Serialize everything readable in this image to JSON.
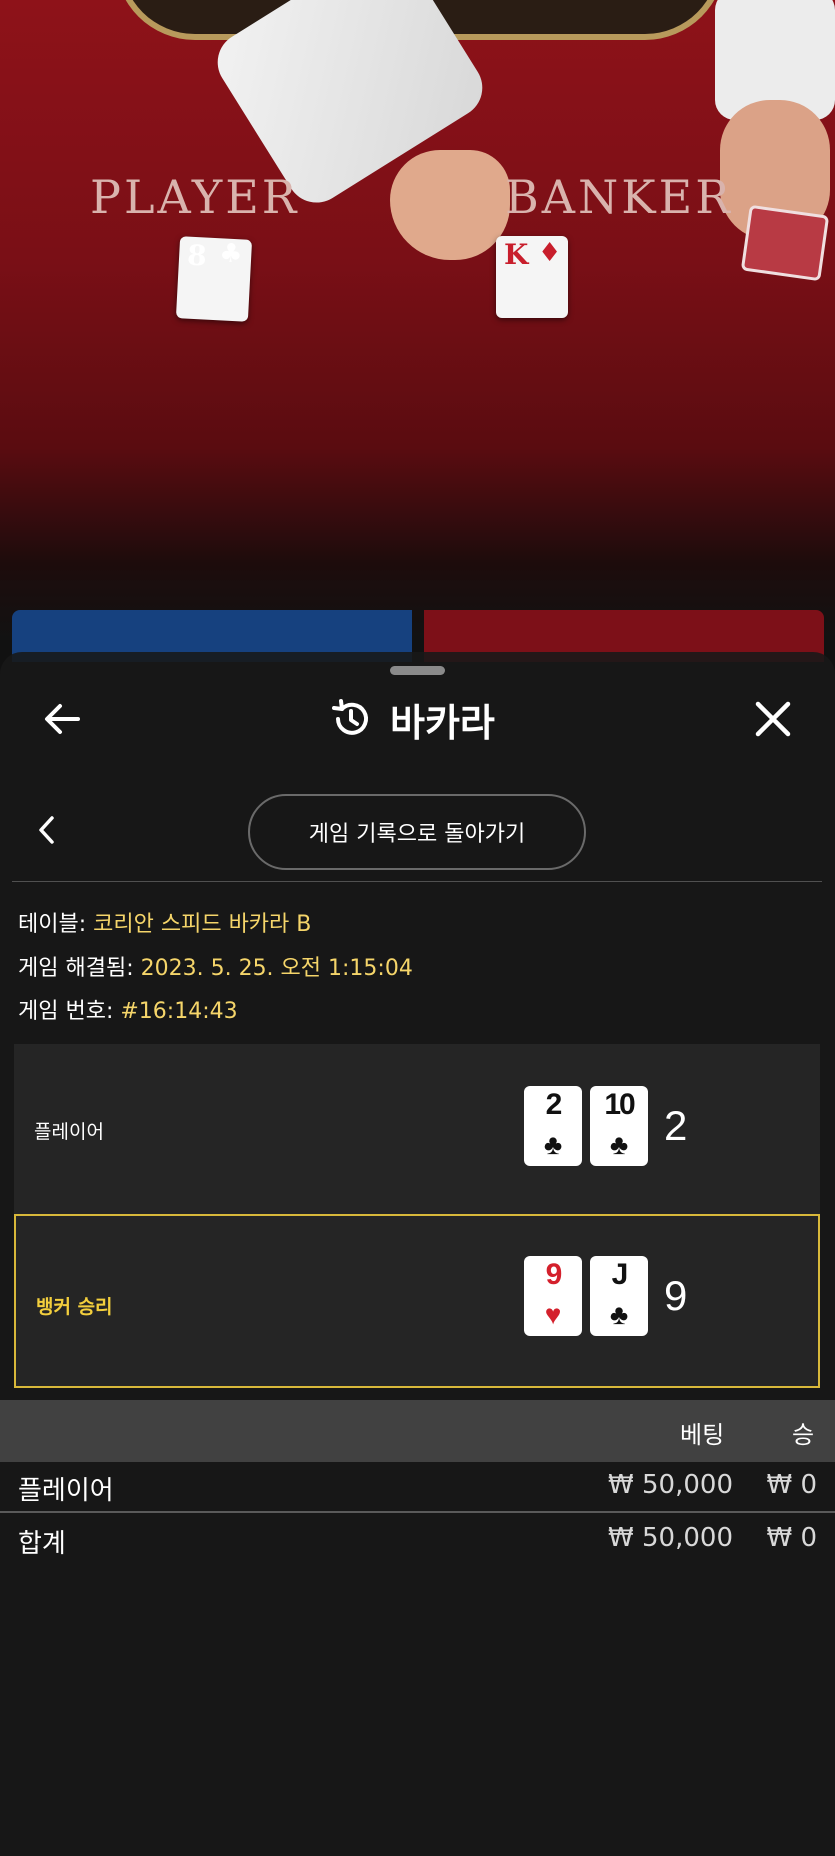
{
  "video": {
    "player_label": "PLAYER",
    "banker_label": "BANKER",
    "player_card": {
      "rank": "8",
      "suit": "♣"
    },
    "banker_card": {
      "rank": "K",
      "suit": "♦"
    }
  },
  "header": {
    "title": "바카라",
    "back_icon": "arrow-left-icon",
    "history_icon": "history-icon",
    "close_icon": "close-icon"
  },
  "nav": {
    "back_to_history_label": "게임 기록으로 돌아가기"
  },
  "info": {
    "table_label": "테이블: ",
    "table_value": "코리안 스피드 바카라 B",
    "resolved_label": "게임 해결됨: ",
    "resolved_value": "2023. 5. 25. 오전 1:15:04",
    "game_no_label": "게임 번호: ",
    "game_no_value": "#16:14:43"
  },
  "results": {
    "player": {
      "label": "플레이어",
      "cards": [
        {
          "rank": "2",
          "suit": "♣",
          "color": "black"
        },
        {
          "rank": "10",
          "suit": "♣",
          "color": "black"
        }
      ],
      "score": "2"
    },
    "banker": {
      "label": "뱅커 승리",
      "cards": [
        {
          "rank": "9",
          "suit": "♥",
          "color": "red"
        },
        {
          "rank": "J",
          "suit": "♣",
          "color": "black"
        }
      ],
      "score": "9",
      "highlight_color": "#d8b83a"
    }
  },
  "bets_table": {
    "columns": [
      "베팅",
      "승"
    ],
    "rows": [
      {
        "label": "플레이어",
        "bet": "₩ 50,000",
        "win": "₩ 0"
      }
    ],
    "total": {
      "label": "합계",
      "bet": "₩ 50,000",
      "win": "₩ 0"
    }
  }
}
